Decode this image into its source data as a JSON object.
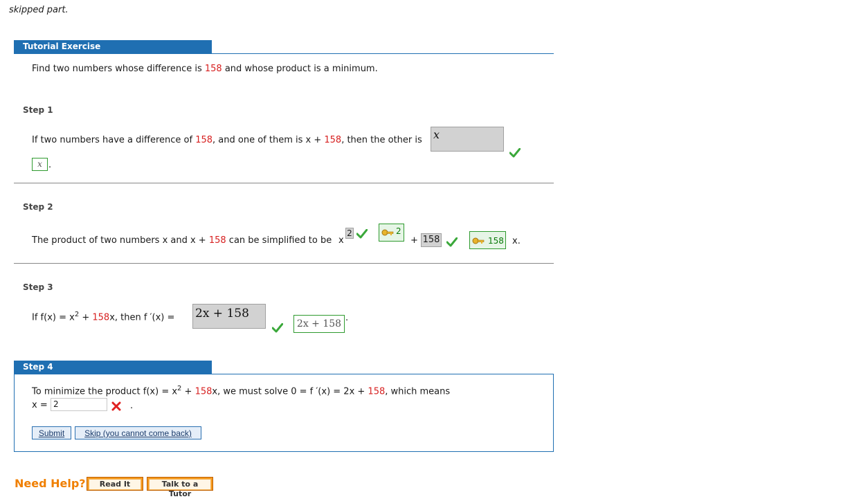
{
  "top_text": "skipped part.",
  "tutorial": {
    "header": "Tutorial Exercise",
    "problem_pre": "Find two numbers whose difference is ",
    "problem_num": "158",
    "problem_post": " and whose product is a minimum."
  },
  "step1": {
    "label": "Step 1",
    "text_a": "If two numbers have a difference of ",
    "num_a": "158",
    "text_b": ", and one of them is x + ",
    "num_b": "158",
    "text_c": ", then the other is",
    "answer_value": "x",
    "correct_value": "x",
    "suffix": "."
  },
  "step2": {
    "label": "Step 2",
    "text_a": "The product of two numbers x and x + ",
    "num_a": "158",
    "text_b": " can be simplified to be",
    "base_var": "x",
    "exponent_value": "2",
    "exponent_key": "2",
    "plus": "+",
    "coef_value": "158",
    "coef_key": "158",
    "tail": "x."
  },
  "step3": {
    "label": "Step 3",
    "text_a": "If f(x) = x",
    "sup": "2",
    "text_b": " + ",
    "num_a": "158",
    "text_c": "x, then f ′(x) =",
    "answer_value": "2x + 158",
    "correct_value": "2x + 158",
    "suffix": "."
  },
  "step4": {
    "label": "Step 4",
    "text_a": "To minimize the product f(x) = x",
    "sup": "2",
    "text_b": " + ",
    "num_a": "158",
    "text_c": "x, we must solve 0 = f ′(x) = 2x + ",
    "num_b": "158",
    "text_d": ", which means",
    "x_label": "x =",
    "x_value": "2",
    "dot": ".",
    "submit_label": "Submit",
    "skip_label": "Skip (you cannot come back)"
  },
  "help": {
    "title": "Need Help?",
    "read_label": "Read It",
    "tutor_label": "Talk to a Tutor"
  },
  "colors": {
    "accent_blue": "#1f6fb2",
    "red": "#d72020",
    "green": "#2e9a2e",
    "orange": "#f07f00"
  }
}
